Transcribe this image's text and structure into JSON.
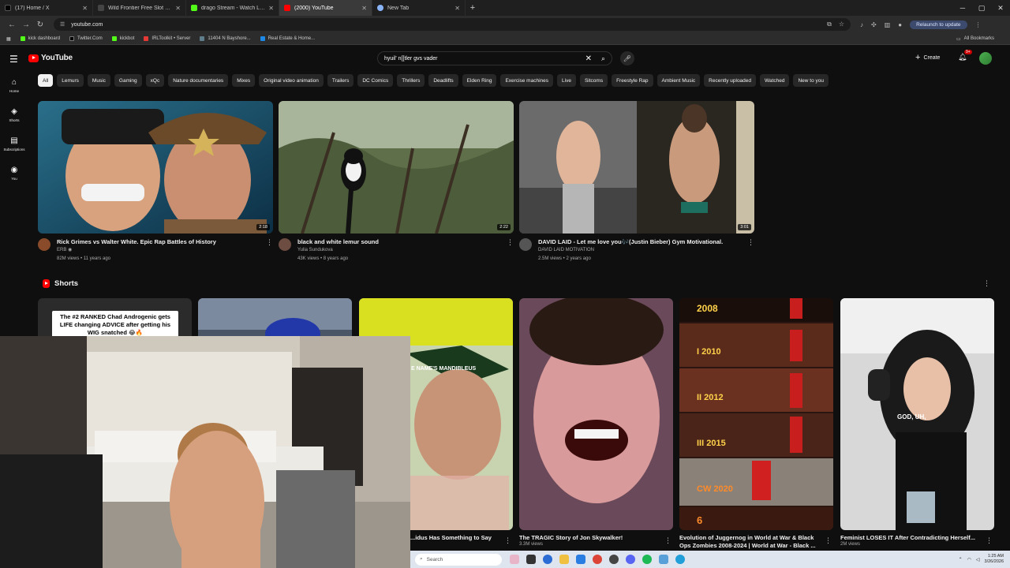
{
  "browser": {
    "tabs": [
      {
        "label": "(17) Home / X",
        "color": "#000000"
      },
      {
        "label": "Wild Frontier Free Slot Game b...",
        "color": "#222222"
      },
      {
        "label": "drago Stream - Watch Live on K...",
        "color": "#53fc18"
      },
      {
        "label": "(2000) YouTube",
        "color": "#ff0000",
        "active": true
      },
      {
        "label": "New Tab",
        "color": "#8ab4f8"
      }
    ],
    "url": "youtube.com",
    "relaunch_label": "Relaunch to update",
    "bookmarks": [
      {
        "label": "kick dashboard",
        "color": "#53fc18"
      },
      {
        "label": "Twitter.Com",
        "color": "#000000"
      },
      {
        "label": "kickbot",
        "color": "#53fc18"
      },
      {
        "label": "IRLToolkit • Server",
        "color": "#e53935"
      },
      {
        "label": "11404 N Bayshore...",
        "color": "#607d8b"
      },
      {
        "label": "Real Estate & Home...",
        "color": "#1e88e5"
      }
    ],
    "all_bookmarks_label": "All Bookmarks"
  },
  "youtube": {
    "logo_text": "YouTube",
    "search_value": "hyuil' n[[tler gvs vader",
    "create_label": "Create",
    "notification_count": "9+",
    "rail": [
      {
        "icon": "home-icon",
        "glyph": "⌂",
        "label": "Home"
      },
      {
        "icon": "shorts-icon",
        "glyph": "◈",
        "label": "Shorts"
      },
      {
        "icon": "subscriptions-icon",
        "glyph": "▤",
        "label": "Subscriptions"
      },
      {
        "icon": "you-icon",
        "glyph": "◉",
        "label": "You"
      }
    ],
    "chips": [
      "All",
      "Lemurs",
      "Music",
      "Gaming",
      "xQc",
      "Nature documentaries",
      "Mixes",
      "Original video animation",
      "Trailers",
      "DC Comics",
      "Thrillers",
      "Deadlifts",
      "Elden Ring",
      "Exercise machines",
      "Live",
      "Sitcoms",
      "Freestyle Rap",
      "Ambient Music",
      "Recently uploaded",
      "Watched",
      "New to you"
    ],
    "videos": [
      {
        "title": "Rick Grimes vs Walter White.  Epic Rap Battles of History",
        "channel": "ERB ◉",
        "stats": "82M views • 11 years ago",
        "duration": "2:18"
      },
      {
        "title": "black and white lemur sound",
        "channel": "Yulia Sundukova",
        "stats": "43K views • 8 years ago",
        "duration": "2:22"
      },
      {
        "title": "DAVID LAID - Let me love you🎶(Justin Bieber) Gym Motivational.",
        "channel": "DAVID LAID MOTIVATION",
        "stats": "2.5M views • 2 years ago",
        "duration": "3:01"
      }
    ],
    "shorts_title": "Shorts",
    "shorts": [
      {
        "title": "",
        "views": "",
        "caption": "The #2 RANKED Chad Androgenic gets LIFE changing ADVICE after getting his WIG snatched 😂🔥"
      },
      {
        "title": "",
        "views": ""
      },
      {
        "title": "...idus Has Something to Say",
        "views": "",
        "overlay": "E NAME'S MANDIBLEUS"
      },
      {
        "title": "The TRAGIC Story of Jon Skywalker!",
        "views": "3.3M views"
      },
      {
        "title": "Evolution of Juggernog in World at War & Black Ops Zombies 2008-2024 | World at War - Black ...",
        "views": "",
        "years": [
          "2008",
          "I 2010",
          "II 2012",
          "III 2015",
          "CW 2020",
          "6"
        ]
      },
      {
        "title": "Feminist LOSES IT After Contradicting Herself...",
        "views": "2M views",
        "overlay": "GOD, UH,"
      }
    ]
  },
  "taskbar": {
    "search_placeholder": "Search",
    "time": "1:25 AM",
    "date": "3/26/2026"
  }
}
